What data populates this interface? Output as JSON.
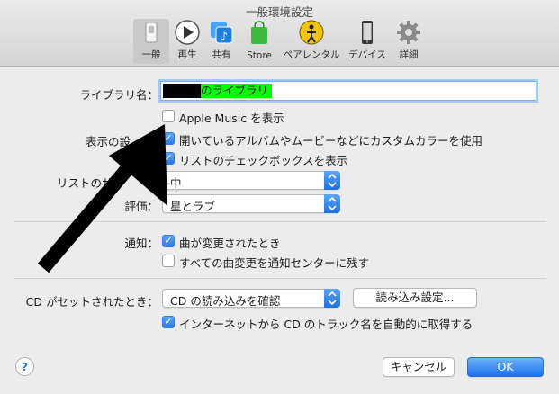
{
  "window": {
    "title": "一般環境設定"
  },
  "toolbar": {
    "tabs": [
      {
        "label": "一般",
        "icon": "general-switch-icon"
      },
      {
        "label": "再生",
        "icon": "play-icon"
      },
      {
        "label": "共有",
        "icon": "music-share-icon"
      },
      {
        "label": "Store",
        "icon": "store-bag-icon"
      },
      {
        "label": "ペアレンタル",
        "icon": "parental-icon"
      },
      {
        "label": "デバイス",
        "icon": "iphone-icon"
      },
      {
        "label": "詳細",
        "icon": "gear-icon"
      }
    ]
  },
  "library": {
    "label": "ライブラリ名：",
    "value": "のライブラリ",
    "highlight_color": "#00ff00"
  },
  "show_section": {
    "label": "表示の設",
    "apple_music": {
      "label": "Apple Music を表示",
      "checked": false
    },
    "custom_colors": {
      "label": "開いているアルバムやムービーなどにカスタムカラーを使用",
      "checked": true
    },
    "list_checkboxes": {
      "label": "リストのチェックボックスを表示",
      "checked": true
    }
  },
  "list_size": {
    "label": "リストのサイ",
    "value": "中"
  },
  "rating": {
    "label": "評価：",
    "value": "星とラブ"
  },
  "notifications": {
    "label": "通知：",
    "song_changes": {
      "label": "曲が変更されたとき",
      "checked": true
    },
    "keep_all": {
      "label": "すべての曲変更を通知センターに残す",
      "checked": false
    }
  },
  "cd": {
    "label": "CD がセットされたとき：",
    "value": "CD の読み込みを確認",
    "import_button": "読み込み設定...",
    "auto_names": {
      "label": "インターネットから CD のトラック名を自動的に取得する",
      "checked": true
    }
  },
  "footer": {
    "help": "?",
    "cancel": "キャンセル",
    "ok": "OK"
  },
  "colors": {
    "accent": "#2c7be3"
  }
}
